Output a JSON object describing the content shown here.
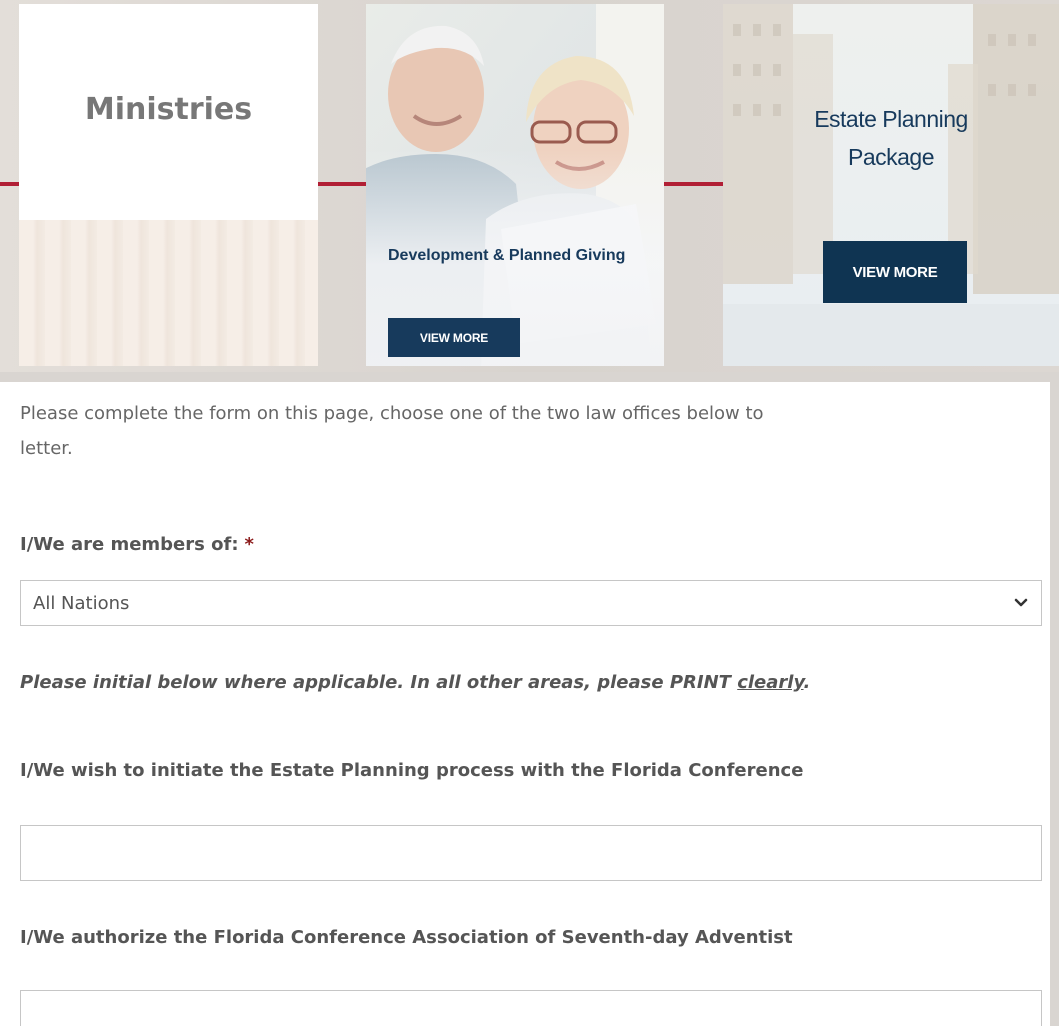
{
  "cards": [
    {
      "title": "Ministries"
    },
    {
      "title": "Development & Planned Giving",
      "button": "VIEW MORE"
    },
    {
      "title_line1": "Estate Planning",
      "title_line2": "Package",
      "button": "VIEW MORE"
    }
  ],
  "form": {
    "intro_line1": "Please complete the form on this page, choose one of the two law offices below to",
    "intro_line2": "letter.",
    "members_label": "I/We are members of:",
    "required_mark": "*",
    "members_value": "All Nations",
    "note_main": "Please initial below where applicable. In all other areas, please PRINT ",
    "note_emph": "clearly",
    "note_end": ".",
    "initiate_label": "I/We wish to initiate the Estate Planning process with the Florida Conference",
    "authorize_label": "I/We authorize the Florida Conference Association of Seventh-day Adventist"
  },
  "colors": {
    "accent_red": "#b11f35",
    "navy": "#173a5c"
  }
}
